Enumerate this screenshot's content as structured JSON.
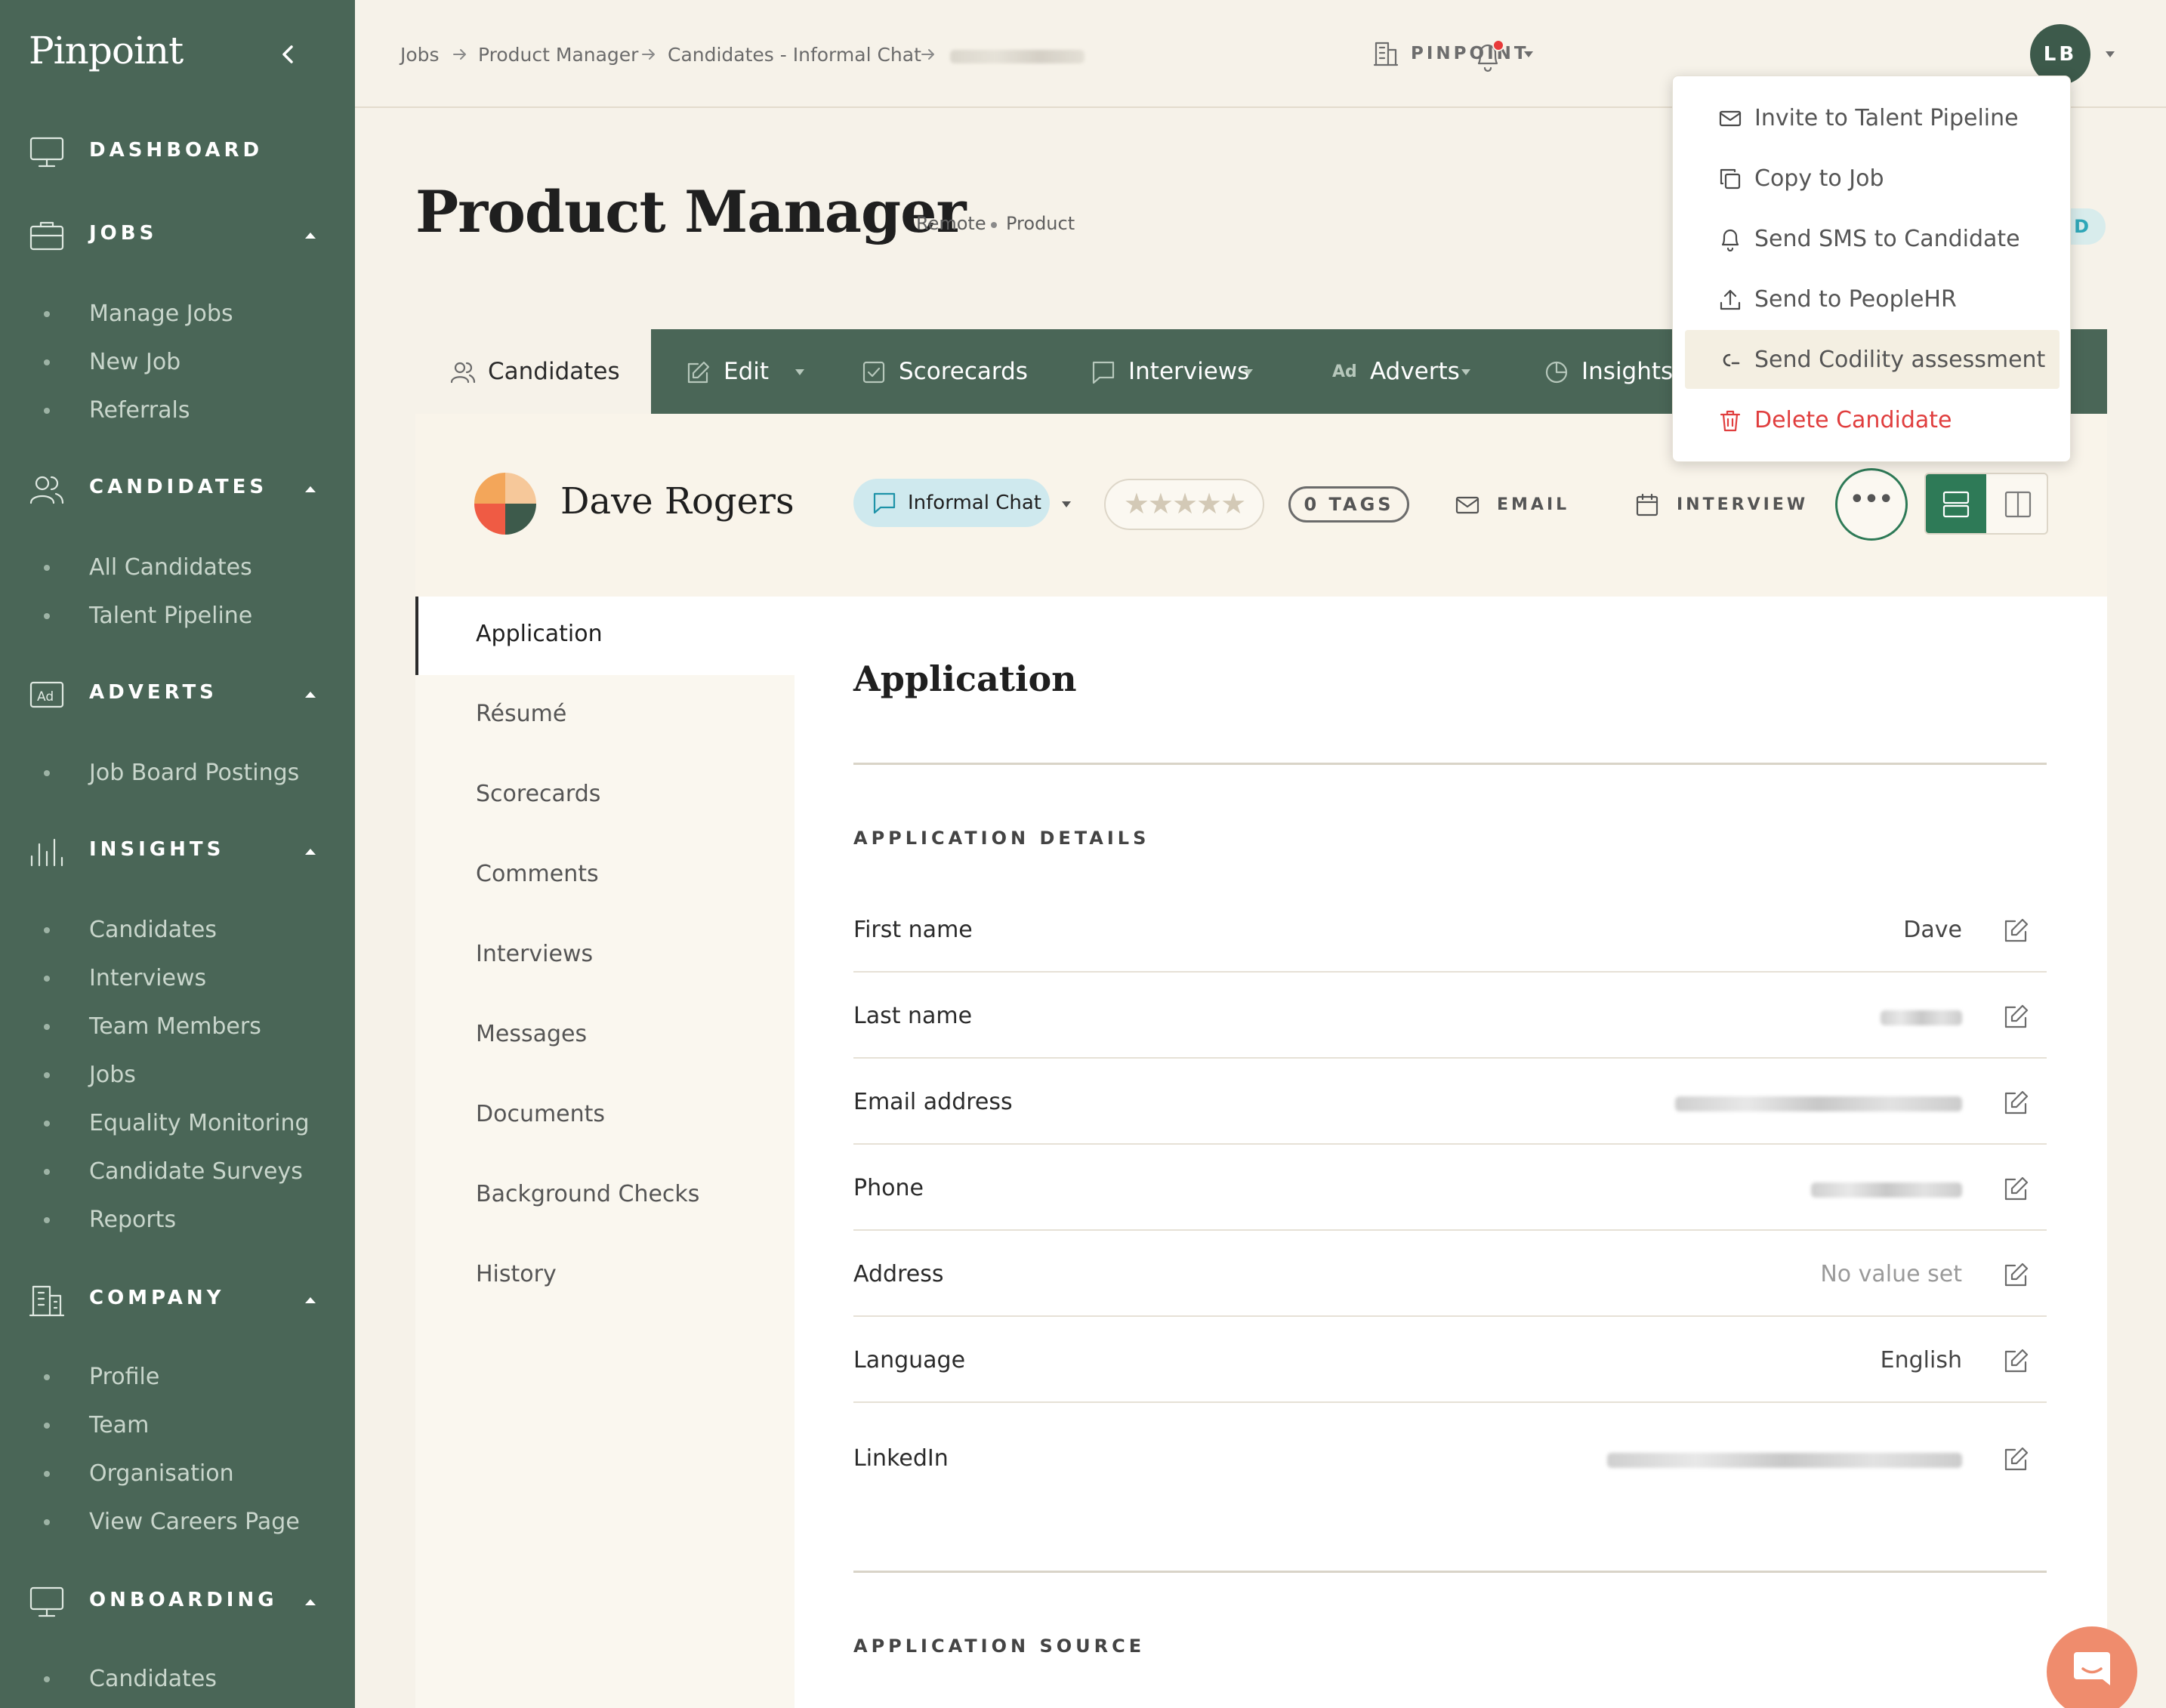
{
  "sidebar": {
    "logo": "Pinpoint",
    "sections": {
      "dashboard": {
        "label": "DASHBOARD",
        "icon": "monitor-icon"
      },
      "jobs": {
        "label": "JOBS",
        "icon": "briefcase-icon",
        "items": [
          "Manage Jobs",
          "New Job",
          "Referrals"
        ]
      },
      "candidates": {
        "label": "CANDIDATES",
        "icon": "users-icon",
        "items": [
          "All Candidates",
          "Talent Pipeline"
        ]
      },
      "adverts": {
        "label": "ADVERTS",
        "icon": "ad-icon",
        "items": [
          "Job Board Postings"
        ]
      },
      "insights": {
        "label": "INSIGHTS",
        "icon": "bar-chart-icon",
        "items": [
          "Candidates",
          "Interviews",
          "Team Members",
          "Jobs",
          "Equality Monitoring",
          "Candidate Surveys",
          "Reports"
        ]
      },
      "company": {
        "label": "COMPANY",
        "icon": "building-icon",
        "items": [
          "Profile",
          "Team",
          "Organisation",
          "View Careers Page"
        ]
      },
      "onboarding": {
        "label": "ONBOARDING",
        "icon": "monitor-icon",
        "items": [
          "Candidates"
        ]
      }
    }
  },
  "topbar": {
    "breadcrumbs": [
      "Jobs",
      "Product Manager",
      "Candidates - Informal Chat"
    ],
    "org_label": "PINPOINT",
    "user_initials": "LB"
  },
  "job": {
    "title": "Product Manager",
    "location": "Remote",
    "department": "Product",
    "status_badge_fragment": "D"
  },
  "tabs": {
    "candidates": "Candidates",
    "edit": "Edit",
    "scorecards": "Scorecards",
    "interviews": "Interviews",
    "adverts": "Adverts",
    "adverts_icon": "Ad",
    "insights": "Insights"
  },
  "candidate": {
    "name": "Dave Rogers",
    "stage": "Informal Chat",
    "rating_stars": "★★★★★",
    "tags": "0 TAGS",
    "email_action": "EMAIL",
    "interview_action": "INTERVIEW",
    "more": "•••",
    "avatar_colors": [
      "#f3a65a",
      "#f6c89a",
      "#ef5b44",
      "#3d5a4b"
    ]
  },
  "subnav": [
    "Application",
    "Résumé",
    "Scorecards",
    "Comments",
    "Interviews",
    "Messages",
    "Documents",
    "Background Checks",
    "History"
  ],
  "application": {
    "title": "Application",
    "details_heading": "APPLICATION DETAILS",
    "source_heading": "APPLICATION SOURCE",
    "fields": [
      {
        "label": "First name",
        "value": "Dave"
      },
      {
        "label": "Last name",
        "value": ""
      },
      {
        "label": "Email address",
        "value": ""
      },
      {
        "label": "Phone",
        "value": ""
      },
      {
        "label": "Address",
        "value": "No value set"
      },
      {
        "label": "Language",
        "value": "English"
      },
      {
        "label": "LinkedIn",
        "value": ""
      }
    ]
  },
  "menu": {
    "items": [
      {
        "label": "Invite to Talent Pipeline",
        "icon": "mail-icon"
      },
      {
        "label": "Copy to Job",
        "icon": "copy-icon"
      },
      {
        "label": "Send SMS to Candidate",
        "icon": "bell-icon"
      },
      {
        "label": "Send to PeopleHR",
        "icon": "upload-icon"
      },
      {
        "label": "Send Codility assessment",
        "icon": "codility-icon"
      },
      {
        "label": "Delete Candidate",
        "icon": "trash-icon"
      }
    ],
    "danger_color": "#e03e3e"
  },
  "colors": {
    "sidebar": "#4a6657",
    "accent_green": "#2e7a57",
    "page_bg": "#f6f2e9",
    "notification": "#e83a3a",
    "chat_button": "#ef8c6d"
  }
}
